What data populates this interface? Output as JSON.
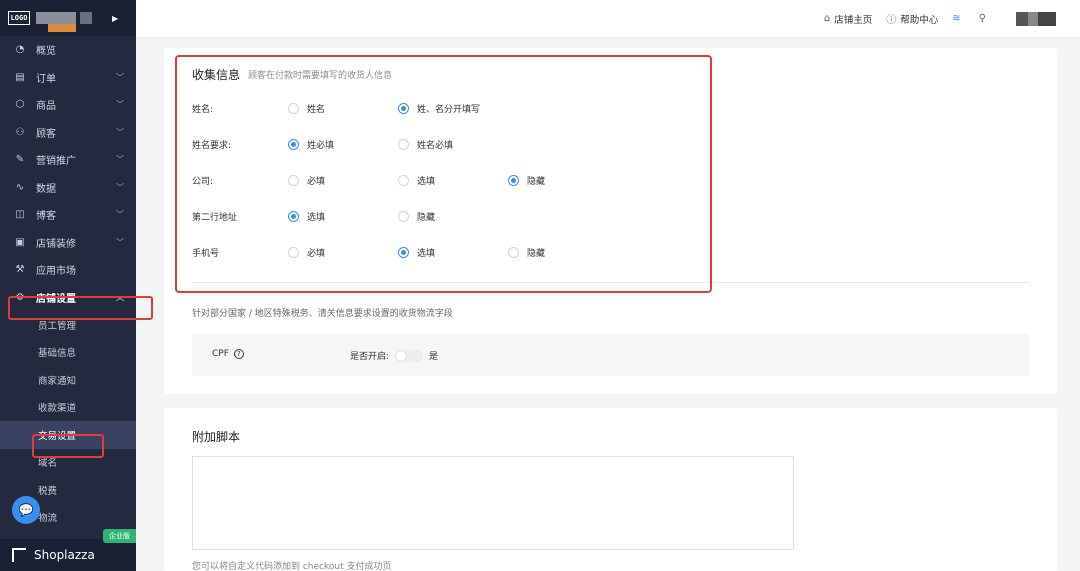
{
  "brand": {
    "logo": "LOGO",
    "collapse_icon": "caret-right-icon"
  },
  "sidebar": {
    "items": [
      {
        "label": "概览",
        "icon": "dashboard-icon",
        "chevron": false
      },
      {
        "label": "订单",
        "icon": "order-icon",
        "chevron": true
      },
      {
        "label": "商品",
        "icon": "product-icon",
        "chevron": true
      },
      {
        "label": "顾客",
        "icon": "customer-icon",
        "chevron": true
      },
      {
        "label": "营销推广",
        "icon": "marketing-icon",
        "chevron": true
      },
      {
        "label": "数据",
        "icon": "data-icon",
        "chevron": true
      },
      {
        "label": "博客",
        "icon": "blog-icon",
        "chevron": true
      },
      {
        "label": "店铺装修",
        "icon": "theme-icon",
        "chevron": true
      },
      {
        "label": "应用市场",
        "icon": "apps-icon",
        "chevron": false
      },
      {
        "label": "店铺设置",
        "icon": "gear-icon",
        "chevron": true,
        "active": true
      }
    ],
    "sub_items": [
      {
        "label": "员工管理"
      },
      {
        "label": "基础信息"
      },
      {
        "label": "商家通知"
      },
      {
        "label": "收款渠道"
      },
      {
        "label": "交易设置",
        "active": true
      },
      {
        "label": "域名"
      },
      {
        "label": "税费"
      },
      {
        "label": "物流"
      }
    ],
    "bottom": {
      "brand": "Shoplazza",
      "badge": "企业版"
    }
  },
  "header": {
    "store_home": "店铺主页",
    "help_center": "帮助中心"
  },
  "collect": {
    "title": "收集信息",
    "desc": "顾客在付款时需要填写的收货人信息",
    "rows": [
      {
        "label": "姓名:",
        "options": [
          "姓名",
          "姓、名分开填写"
        ],
        "selected": 1
      },
      {
        "label": "姓名要求:",
        "options": [
          "姓必填",
          "姓名必填"
        ],
        "selected": 0
      },
      {
        "label": "公司:",
        "options": [
          "必填",
          "选填",
          "隐藏"
        ],
        "selected": 2
      },
      {
        "label": "第二行地址",
        "options": [
          "选填",
          "隐藏"
        ],
        "selected": 0
      },
      {
        "label": "手机号",
        "options": [
          "必填",
          "选填",
          "隐藏"
        ],
        "selected": 1
      }
    ],
    "note": "针对部分国家 / 地区特殊税务、清关信息要求设置的收货物流字段",
    "cpf_label": "CPF",
    "cpf_switch_label": "是否开启:",
    "cpf_switch_value": "是"
  },
  "script": {
    "title": "附加脚本",
    "note": "您可以将自定义代码添加到 checkout 支付成功页"
  },
  "colors": {
    "accent": "#3a8df0",
    "highlight": "#e03c3c",
    "sidebar_bg": "#232a40"
  }
}
